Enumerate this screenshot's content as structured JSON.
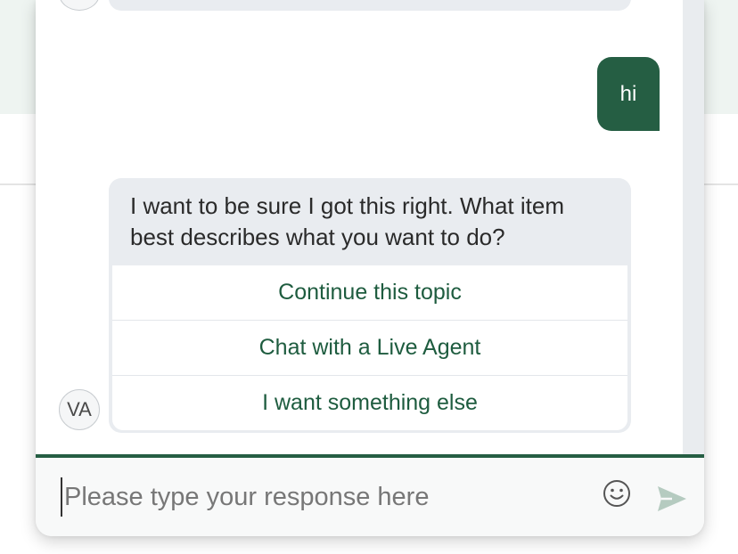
{
  "conversation": {
    "user_message": "hi",
    "bot_message": "I want to be sure I got this right. What item best describes what you want to do?",
    "options": [
      {
        "label": "Continue this topic"
      },
      {
        "label": "Chat with a Live Agent"
      },
      {
        "label": "I want something else"
      }
    ],
    "bot_avatar_initials": "VA"
  },
  "composer": {
    "placeholder": "Please type your response here",
    "emoji_icon": "smiley-icon",
    "send_icon": "paper-plane-send-icon"
  },
  "colors": {
    "accent": "#255e43",
    "bot_bubble": "#e9ecf0",
    "option_text": "#1e5c3f",
    "page_band": "#eef4f1"
  }
}
